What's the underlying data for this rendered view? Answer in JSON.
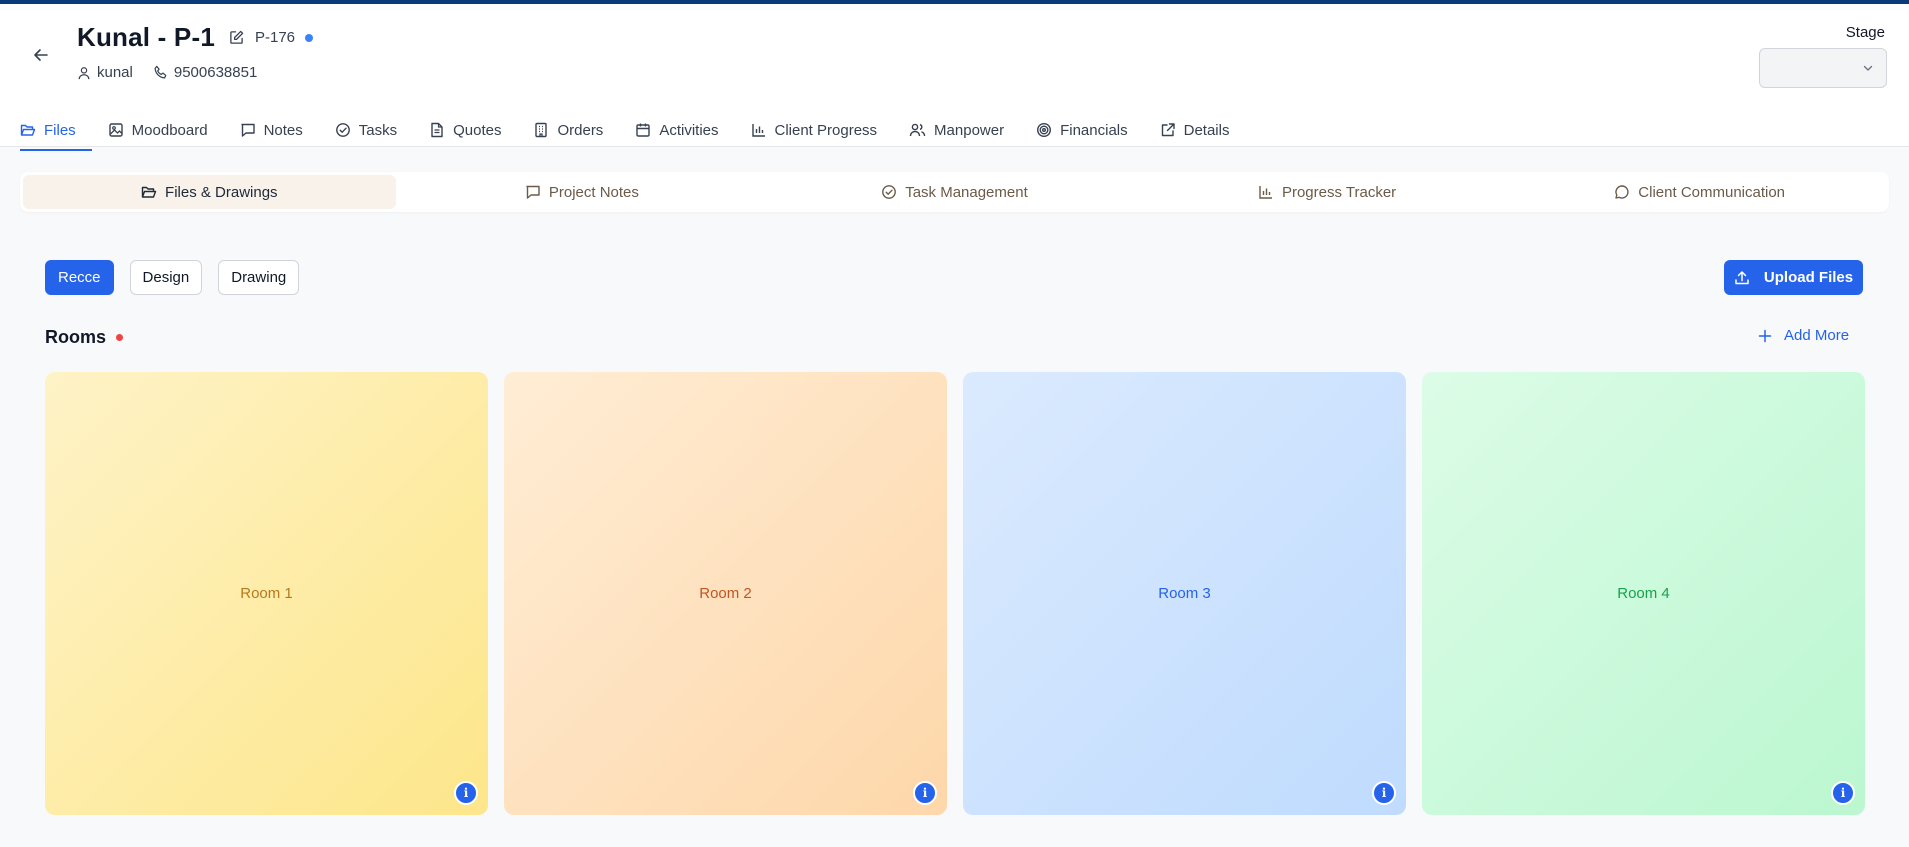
{
  "header": {
    "title": "Kunal - P-1",
    "code": "P-176",
    "user": "kunal",
    "phone": "9500638851",
    "stage_label": "Stage",
    "stage_value": ""
  },
  "tabs": [
    {
      "label": "Files",
      "icon": "folder-open-icon",
      "active": true
    },
    {
      "label": "Moodboard",
      "icon": "image-icon"
    },
    {
      "label": "Notes",
      "icon": "message-square-icon"
    },
    {
      "label": "Tasks",
      "icon": "check-circle-icon"
    },
    {
      "label": "Quotes",
      "icon": "file-text-icon"
    },
    {
      "label": "Orders",
      "icon": "building-icon"
    },
    {
      "label": "Activities",
      "icon": "calendar-icon"
    },
    {
      "label": "Client Progress",
      "icon": "bar-chart-icon"
    },
    {
      "label": "Manpower",
      "icon": "users-icon"
    },
    {
      "label": "Financials",
      "icon": "target-icon"
    },
    {
      "label": "Details",
      "icon": "external-link-icon"
    }
  ],
  "subnav": [
    {
      "label": "Files & Drawings",
      "icon": "folder-open-icon",
      "active": true
    },
    {
      "label": "Project Notes",
      "icon": "message-square-icon"
    },
    {
      "label": "Task Management",
      "icon": "check-circle-icon"
    },
    {
      "label": "Progress Tracker",
      "icon": "bar-chart-icon"
    },
    {
      "label": "Client Communication",
      "icon": "message-circle-icon"
    }
  ],
  "filters": [
    {
      "label": "Recce",
      "active": true
    },
    {
      "label": "Design"
    },
    {
      "label": "Drawing"
    }
  ],
  "upload_label": "Upload Files",
  "rooms_section": {
    "title": "Rooms",
    "add_more": "Add More"
  },
  "rooms": [
    {
      "name": "Room 1",
      "text_color": "#b7791f",
      "bg_from": "#fef3c7",
      "bg_to": "#fde68a"
    },
    {
      "name": "Room 2",
      "text_color": "#c05621",
      "bg_from": "#ffedd5",
      "bg_to": "#fed7aa"
    },
    {
      "name": "Room 3",
      "text_color": "#2563eb",
      "bg_from": "#dbeafe",
      "bg_to": "#bfdbfe"
    },
    {
      "name": "Room 4",
      "text_color": "#16a34a",
      "bg_from": "#dcfce7",
      "bg_to": "#bbf7d0"
    }
  ],
  "info_glyph": "i",
  "colors": {
    "primary": "#2563eb",
    "topbar": "#0b3a78",
    "status_dot": "#3b82f6",
    "required_dot": "#ef4444"
  }
}
